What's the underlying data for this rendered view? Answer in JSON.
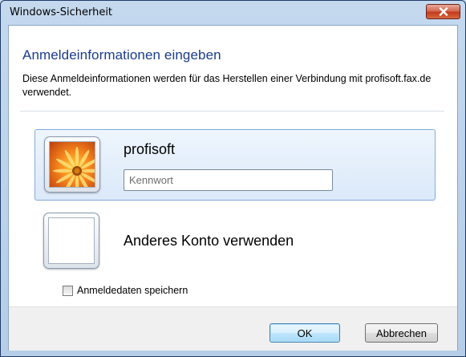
{
  "window": {
    "title": "Windows-Sicherheit"
  },
  "dialog": {
    "heading": "Anmeldeinformationen eingeben",
    "description": "Diese Anmeldeinformationen werden für das Herstellen einer Verbindung mit profisoft.fax.de verwendet."
  },
  "accounts": {
    "selected": {
      "username": "profisoft",
      "password_placeholder": "Kennwort",
      "password_value": "",
      "avatar_icon": "flower-avatar-icon"
    },
    "other": {
      "label": "Anderes Konto verwenden",
      "avatar_icon": "blank-avatar-icon"
    }
  },
  "remember": {
    "label": "Anmeldedaten speichern",
    "checked": false
  },
  "buttons": {
    "ok": "OK",
    "cancel": "Abbrechen"
  },
  "colors": {
    "heading": "#1a3c8c",
    "close_button": "#c23a1c",
    "selection": "#dbe9f9"
  }
}
